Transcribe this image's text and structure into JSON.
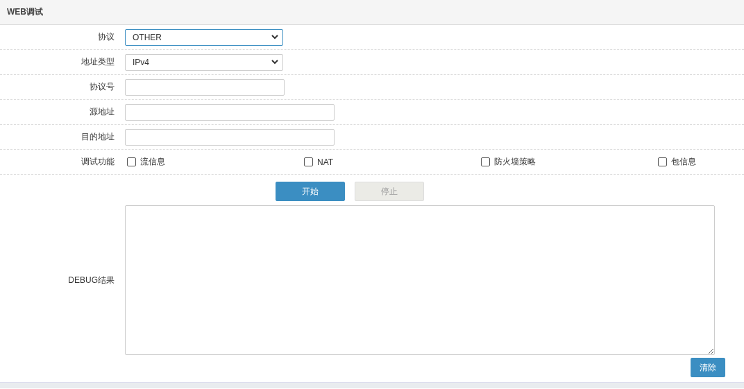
{
  "panel": {
    "title": "WEB调试"
  },
  "fields": [
    {
      "label": "协议",
      "kind": "select",
      "value": "OTHER",
      "focused": true
    },
    {
      "label": "地址类型",
      "kind": "select",
      "value": "IPv4",
      "focused": false
    },
    {
      "label": "协议号",
      "kind": "number"
    },
    {
      "label": "源地址",
      "kind": "text"
    },
    {
      "label": "目的地址",
      "kind": "text"
    }
  ],
  "debug_functions": {
    "label": "调试功能",
    "options": [
      {
        "label": "流信息",
        "checked": false
      },
      {
        "label": "NAT",
        "checked": false
      },
      {
        "label": "防火墙策略",
        "checked": false
      },
      {
        "label": "包信息",
        "checked": false
      }
    ]
  },
  "actions": [
    {
      "label": "开始",
      "disabled": false
    },
    {
      "label": "停止",
      "disabled": true
    }
  ],
  "result": {
    "label": "DEBUG结果"
  },
  "clear_button": {
    "label": "清除"
  }
}
